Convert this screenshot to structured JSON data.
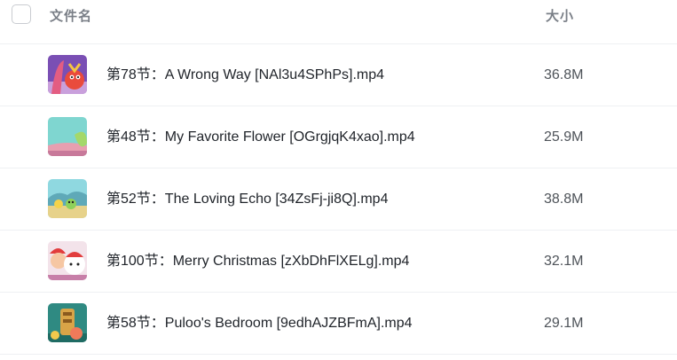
{
  "header": {
    "name_label": "文件名",
    "size_label": "大小"
  },
  "files": [
    {
      "name": "第78节：A Wrong Way [NAl3u4SPhPs].mp4",
      "size": "36.8M",
      "thumbnail": "cartoon-thumbnail"
    },
    {
      "name": "第48节：My Favorite Flower [OGrgjqK4xao].mp4",
      "size": "25.9M",
      "thumbnail": "cartoon-thumbnail"
    },
    {
      "name": "第52节：The Loving Echo [34ZsFj-ji8Q].mp4",
      "size": "38.8M",
      "thumbnail": "cartoon-thumbnail"
    },
    {
      "name": "第100节：Merry Christmas [zXbDhFlXELg].mp4",
      "size": "32.1M",
      "thumbnail": "cartoon-thumbnail"
    },
    {
      "name": "第58节：Puloo's Bedroom [9edhAJZBFmA].mp4",
      "size": "29.1M",
      "thumbnail": "cartoon-thumbnail"
    }
  ],
  "colors": {
    "divider": "#eef0f3",
    "header_text": "#7a7f87",
    "name_text": "#1f2329",
    "size_text": "#4e5359"
  }
}
